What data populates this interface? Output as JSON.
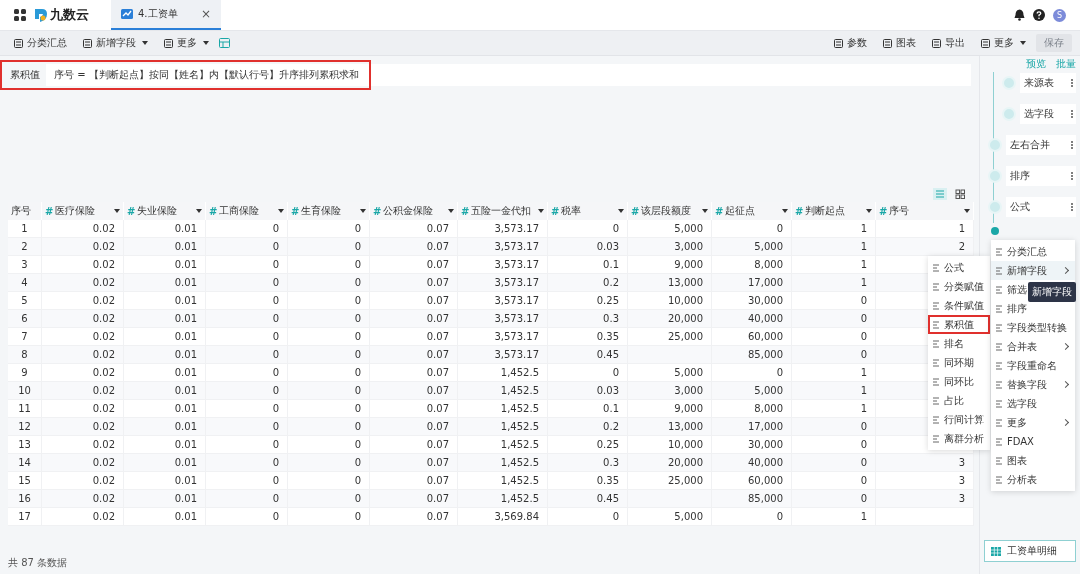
{
  "app": {
    "logo": "九数云"
  },
  "tabs": [
    {
      "label": "4.工资单",
      "selected": true,
      "close": "×"
    }
  ],
  "user": {
    "avatar": "S"
  },
  "toolbar": {
    "left": [
      {
        "label": "分类汇总",
        "dropdown": false
      },
      {
        "label": "新增字段",
        "dropdown": true
      },
      {
        "label": "更多",
        "dropdown": true
      }
    ],
    "right": [
      {
        "label": "参数",
        "dropdown": false
      },
      {
        "label": "图表",
        "dropdown": false
      },
      {
        "label": "导出",
        "dropdown": false
      },
      {
        "label": "更多",
        "dropdown": true
      }
    ],
    "save": {
      "label": "保存",
      "disabled": true
    }
  },
  "formula": {
    "label": "累积值",
    "text": "序号 = 【判断起点】按同【姓名】内【默认行号】升序排列累积求和",
    "highlighted": true
  },
  "table": {
    "columns": [
      {
        "label": "序号",
        "sortable": false
      },
      {
        "label": "医疗保险",
        "type": "#",
        "sortable": true
      },
      {
        "label": "失业保险",
        "type": "#",
        "sortable": true
      },
      {
        "label": "工商保险",
        "type": "#",
        "sortable": true
      },
      {
        "label": "生育保险",
        "type": "#",
        "sortable": true
      },
      {
        "label": "公积金保险",
        "type": "#",
        "sortable": true
      },
      {
        "label": "五险一金代扣",
        "type": "#",
        "sortable": true
      },
      {
        "label": "税率",
        "type": "#",
        "sortable": true
      },
      {
        "label": "该层段额度",
        "type": "#",
        "sortable": true
      },
      {
        "label": "起征点",
        "type": "#",
        "sortable": true
      },
      {
        "label": "判断起点",
        "type": "#",
        "sortable": true
      },
      {
        "label": "序号",
        "type": "#",
        "sortable": true
      }
    ],
    "rows": [
      {
        "cells": [
          "1",
          "0.02",
          "0.01",
          "0",
          "0",
          "0.07",
          "3,573.17",
          "0",
          "5,000",
          "0",
          "1"
        ],
        "seq": "1"
      },
      {
        "cells": [
          "2",
          "0.02",
          "0.01",
          "0",
          "0",
          "0.07",
          "3,573.17",
          "0.03",
          "3,000",
          "5,000",
          "1"
        ],
        "seq": "2"
      },
      {
        "cells": [
          "3",
          "0.02",
          "0.01",
          "0",
          "0",
          "0.07",
          "3,573.17",
          "0.1",
          "9,000",
          "8,000",
          "1"
        ]
      },
      {
        "cells": [
          "4",
          "0.02",
          "0.01",
          "0",
          "0",
          "0.07",
          "3,573.17",
          "0.2",
          "13,000",
          "17,000",
          "1"
        ]
      },
      {
        "cells": [
          "5",
          "0.02",
          "0.01",
          "0",
          "0",
          "0.07",
          "3,573.17",
          "0.25",
          "10,000",
          "30,000",
          "0"
        ]
      },
      {
        "cells": [
          "6",
          "0.02",
          "0.01",
          "0",
          "0",
          "0.07",
          "3,573.17",
          "0.3",
          "20,000",
          "40,000",
          "0"
        ]
      },
      {
        "cells": [
          "7",
          "0.02",
          "0.01",
          "0",
          "0",
          "0.07",
          "3,573.17",
          "0.35",
          "25,000",
          "60,000",
          "0"
        ]
      },
      {
        "cells": [
          "8",
          "0.02",
          "0.01",
          "0",
          "0",
          "0.07",
          "3,573.17",
          "0.45",
          null,
          "85,000",
          "0"
        ]
      },
      {
        "cells": [
          "9",
          "0.02",
          "0.01",
          "0",
          "0",
          "0.07",
          "1,452.5",
          "0",
          "5,000",
          "0",
          "1"
        ]
      },
      {
        "cells": [
          "10",
          "0.02",
          "0.01",
          "0",
          "0",
          "0.07",
          "1,452.5",
          "0.03",
          "3,000",
          "5,000",
          "1"
        ]
      },
      {
        "cells": [
          "11",
          "0.02",
          "0.01",
          "0",
          "0",
          "0.07",
          "1,452.5",
          "0.1",
          "9,000",
          "8,000",
          "1"
        ]
      },
      {
        "cells": [
          "12",
          "0.02",
          "0.01",
          "0",
          "0",
          "0.07",
          "1,452.5",
          "0.2",
          "13,000",
          "17,000",
          "0"
        ]
      },
      {
        "cells": [
          "13",
          "0.02",
          "0.01",
          "0",
          "0",
          "0.07",
          "1,452.5",
          "0.25",
          "10,000",
          "30,000",
          "0"
        ]
      },
      {
        "cells": [
          "14",
          "0.02",
          "0.01",
          "0",
          "0",
          "0.07",
          "1,452.5",
          "0.3",
          "20,000",
          "40,000",
          "0"
        ],
        "seq": "3"
      },
      {
        "cells": [
          "15",
          "0.02",
          "0.01",
          "0",
          "0",
          "0.07",
          "1,452.5",
          "0.35",
          "25,000",
          "60,000",
          "0"
        ],
        "seq": "3"
      },
      {
        "cells": [
          "16",
          "0.02",
          "0.01",
          "0",
          "0",
          "0.07",
          "1,452.5",
          "0.45",
          null,
          "85,000",
          "0"
        ],
        "seq": "3"
      },
      {
        "cells": [
          "17",
          "0.02",
          "0.01",
          "0",
          "0",
          "0.07",
          "3,569.84",
          "0",
          "5,000",
          "0",
          "1"
        ]
      }
    ]
  },
  "footer": "共 87 条数据",
  "flow": {
    "actions": [
      "预览",
      "批量"
    ],
    "nodes": [
      {
        "label": "来源表",
        "branch": true
      },
      {
        "label": "选字段",
        "branch": true
      },
      {
        "label": "左右合并",
        "branch": false
      },
      {
        "label": "排序",
        "branch": false
      },
      {
        "label": "公式",
        "branch": false
      }
    ],
    "bottom": "工资单明细"
  },
  "menu": [
    {
      "label": "分类汇总",
      "selected": false
    },
    {
      "label": "新增字段",
      "submenu": true,
      "selected": true
    },
    {
      "label": "筛选",
      "selected": false
    },
    {
      "label": "排序",
      "selected": false
    },
    {
      "label": "字段类型转换",
      "selected": false
    },
    {
      "label": "合并表",
      "submenu": true,
      "selected": false
    },
    {
      "label": "字段重命名",
      "selected": false
    },
    {
      "label": "替换字段",
      "submenu": true,
      "selected": false
    },
    {
      "label": "选字段",
      "selected": false
    },
    {
      "label": "更多",
      "submenu": true,
      "selected": false
    },
    {
      "label": "FDAX",
      "selected": false
    },
    {
      "label": "图表",
      "selected": false
    },
    {
      "label": "分析表",
      "selected": false
    }
  ],
  "tooltip": "新增字段",
  "submenu": [
    {
      "label": "公式",
      "selected": false
    },
    {
      "label": "分类赋值",
      "selected": false
    },
    {
      "label": "条件赋值",
      "selected": false
    },
    {
      "label": "累积值",
      "selected": true
    },
    {
      "label": "排名",
      "selected": false
    },
    {
      "label": "同环期",
      "selected": false
    },
    {
      "label": "同环比",
      "selected": false
    },
    {
      "label": "占比",
      "selected": false
    },
    {
      "label": "行间计算",
      "selected": false
    },
    {
      "label": "离群分析",
      "selected": false
    }
  ]
}
